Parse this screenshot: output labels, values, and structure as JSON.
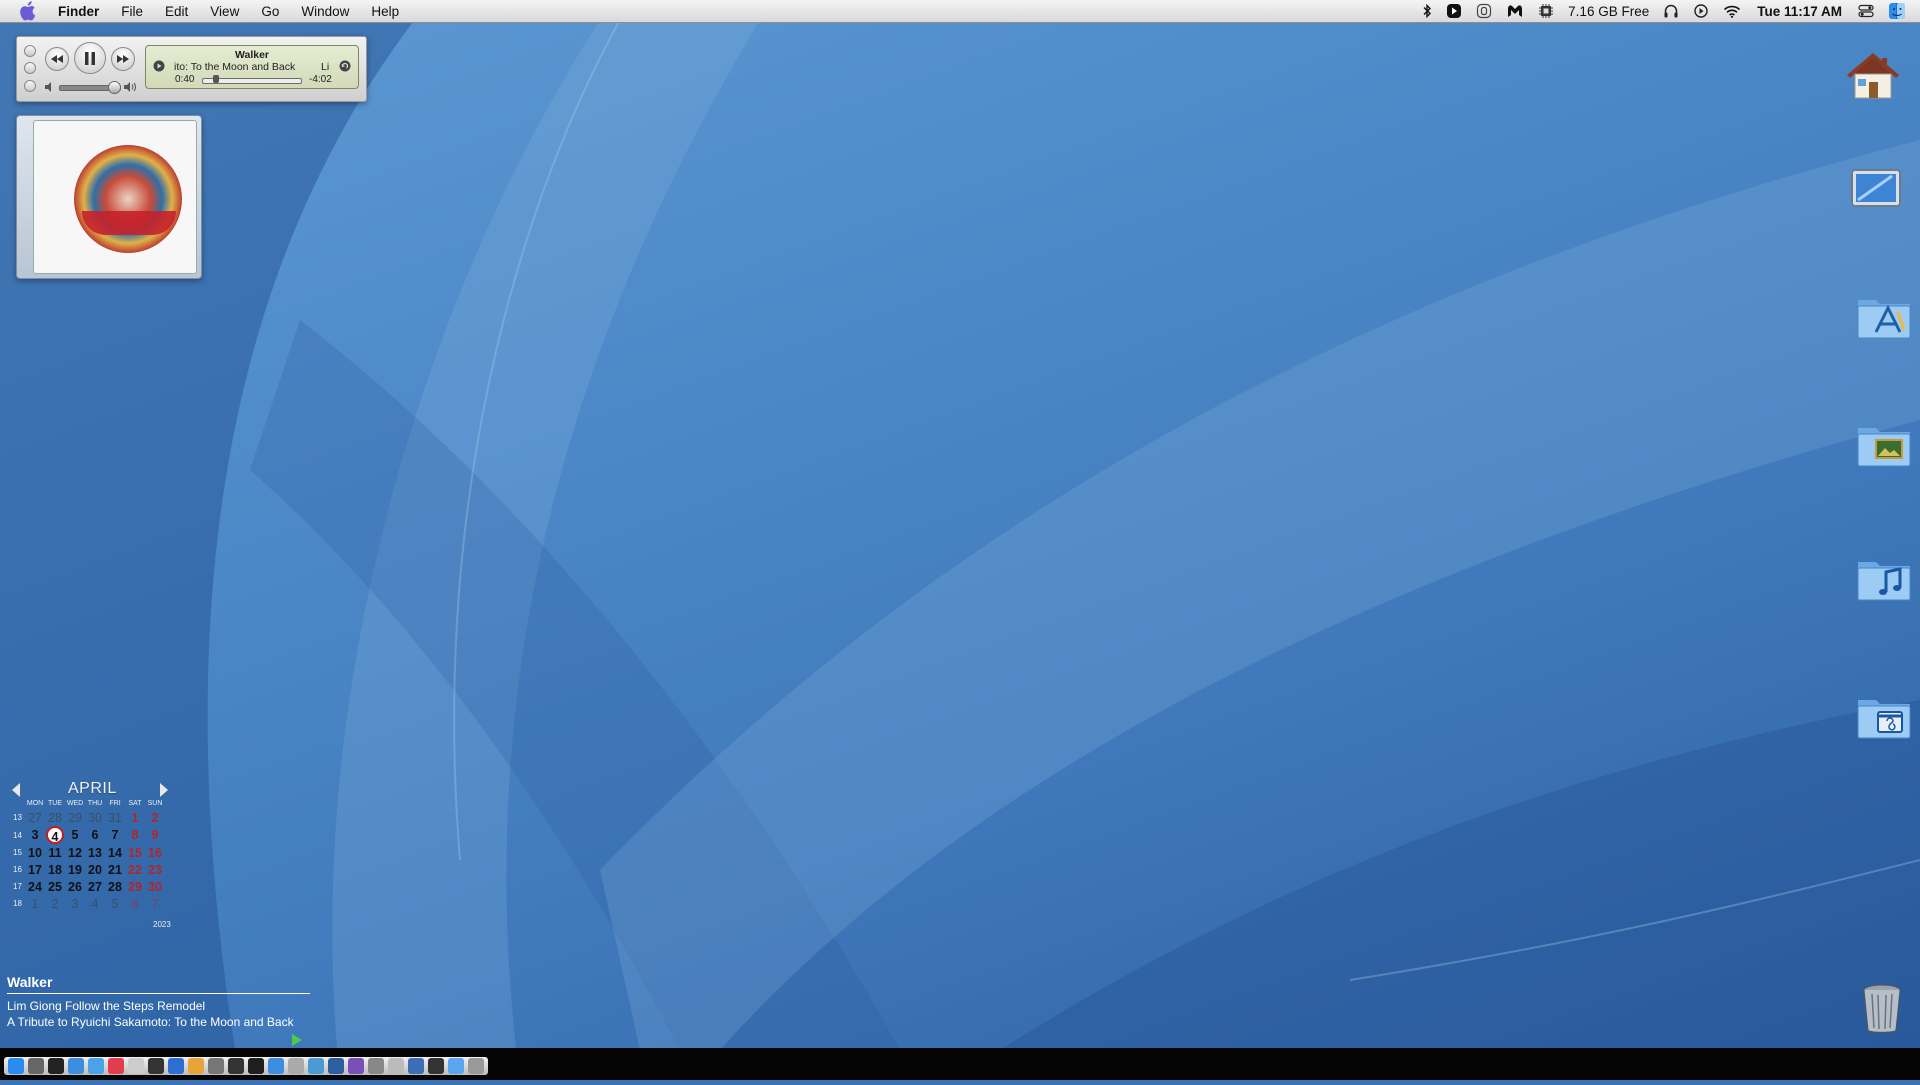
{
  "menubar": {
    "app_name": "Finder",
    "menus": [
      "File",
      "Edit",
      "View",
      "Go",
      "Window",
      "Help"
    ],
    "disk_free": "7.16 GB Free",
    "clock": "Tue 11:17 AM",
    "status_icons": [
      "bluetooth-icon",
      "play-circle-icon",
      "timer-icon",
      "malwarebytes-icon",
      "memory-chip-icon",
      "headphones-icon",
      "media-play-icon",
      "wifi-icon",
      "control-center-icon",
      "finder-face-icon"
    ]
  },
  "miniplayer": {
    "title": "Walker",
    "subtitle": "ito: To the Moon and Back",
    "subtitle_right": "Li",
    "elapsed": "0:40",
    "remaining": "-4:02",
    "progress_fraction": 0.14,
    "volume_fraction": 0.9
  },
  "calendar": {
    "month": "APRIL",
    "year": "2023",
    "weekdays": [
      "MON",
      "TUE",
      "WED",
      "THU",
      "FRI",
      "SAT",
      "SUN"
    ],
    "weeks": [
      {
        "wk": "13",
        "days": [
          "27",
          "28",
          "29",
          "30",
          "31",
          "1",
          "2"
        ]
      },
      {
        "wk": "14",
        "days": [
          "3",
          "4",
          "5",
          "6",
          "7",
          "8",
          "9"
        ]
      },
      {
        "wk": "15",
        "days": [
          "10",
          "11",
          "12",
          "13",
          "14",
          "15",
          "16"
        ]
      },
      {
        "wk": "16",
        "days": [
          "17",
          "18",
          "19",
          "20",
          "21",
          "22",
          "23"
        ]
      },
      {
        "wk": "17",
        "days": [
          "24",
          "25",
          "26",
          "27",
          "28",
          "29",
          "30"
        ]
      },
      {
        "wk": "18",
        "days": [
          "1",
          "2",
          "3",
          "4",
          "5",
          "6",
          "7"
        ]
      }
    ],
    "today": "4"
  },
  "now_playing": {
    "track": "Walker",
    "artist_album": "Lim Giong Follow the Steps Remodel",
    "album": "A Tribute to Ryuichi Sakamoto: To the Moon and Back"
  },
  "desktop_icons": [
    "home-icon",
    "display-icon",
    "applications-folder-icon",
    "pictures-folder-icon",
    "music-folder-icon",
    "movies-folder-icon",
    "trash-icon"
  ],
  "colors": {
    "wallpaper": "#4d89c8",
    "today_ring": "#c31c23",
    "weekend": "#b4242a",
    "play_green": "#4fc94b"
  }
}
